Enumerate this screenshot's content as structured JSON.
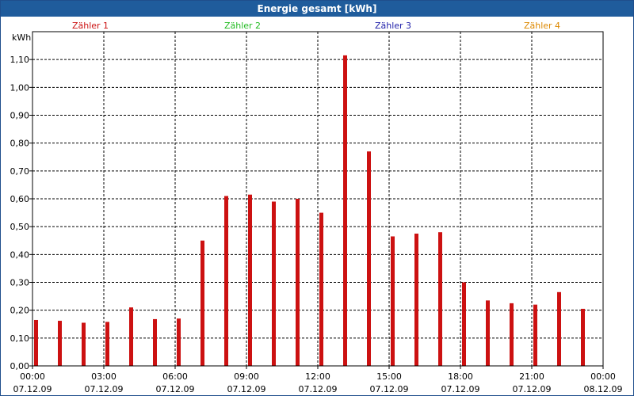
{
  "window": {
    "title": "Energie gesamt [kWh]"
  },
  "legend": [
    {
      "label": "Zähler 1",
      "color": "#cc1111"
    },
    {
      "label": "Zähler 2",
      "color": "#22bb22"
    },
    {
      "label": "Zähler 3",
      "color": "#2222aa"
    },
    {
      "label": "Zähler 4",
      "color": "#dd8800"
    }
  ],
  "chart_data": {
    "type": "bar",
    "title": "Energie gesamt [kWh]",
    "ylabel": "kWh",
    "xlabel": "",
    "ylim": [
      0,
      1.2
    ],
    "grid": true,
    "y_ticks": [
      "0,00",
      "0,10",
      "0,20",
      "0,30",
      "0,40",
      "0,50",
      "0,60",
      "0,70",
      "0,80",
      "0,90",
      "1,00",
      "1,10"
    ],
    "x_ticks": [
      {
        "time": "00:00",
        "date": "07.12.09"
      },
      {
        "time": "03:00",
        "date": "07.12.09"
      },
      {
        "time": "06:00",
        "date": "07.12.09"
      },
      {
        "time": "09:00",
        "date": "07.12.09"
      },
      {
        "time": "12:00",
        "date": "07.12.09"
      },
      {
        "time": "15:00",
        "date": "07.12.09"
      },
      {
        "time": "18:00",
        "date": "07.12.09"
      },
      {
        "time": "21:00",
        "date": "07.12.09"
      },
      {
        "time": "00:00",
        "date": "08.12.09"
      }
    ],
    "categories": [
      "00:00",
      "01:00",
      "02:00",
      "03:00",
      "04:00",
      "05:00",
      "06:00",
      "07:00",
      "08:00",
      "09:00",
      "10:00",
      "11:00",
      "12:00",
      "13:00",
      "14:00",
      "15:00",
      "16:00",
      "17:00",
      "18:00",
      "19:00",
      "20:00",
      "21:00",
      "22:00",
      "23:00"
    ],
    "series": [
      {
        "name": "Zähler 1",
        "color": "#cc1111",
        "values": [
          0.165,
          0.162,
          0.155,
          0.158,
          0.21,
          0.168,
          0.17,
          0.45,
          0.61,
          0.615,
          0.59,
          0.6,
          0.55,
          1.115,
          0.77,
          0.465,
          0.475,
          0.48,
          0.3,
          0.235,
          0.225,
          0.22,
          0.265,
          0.205
        ]
      }
    ]
  }
}
